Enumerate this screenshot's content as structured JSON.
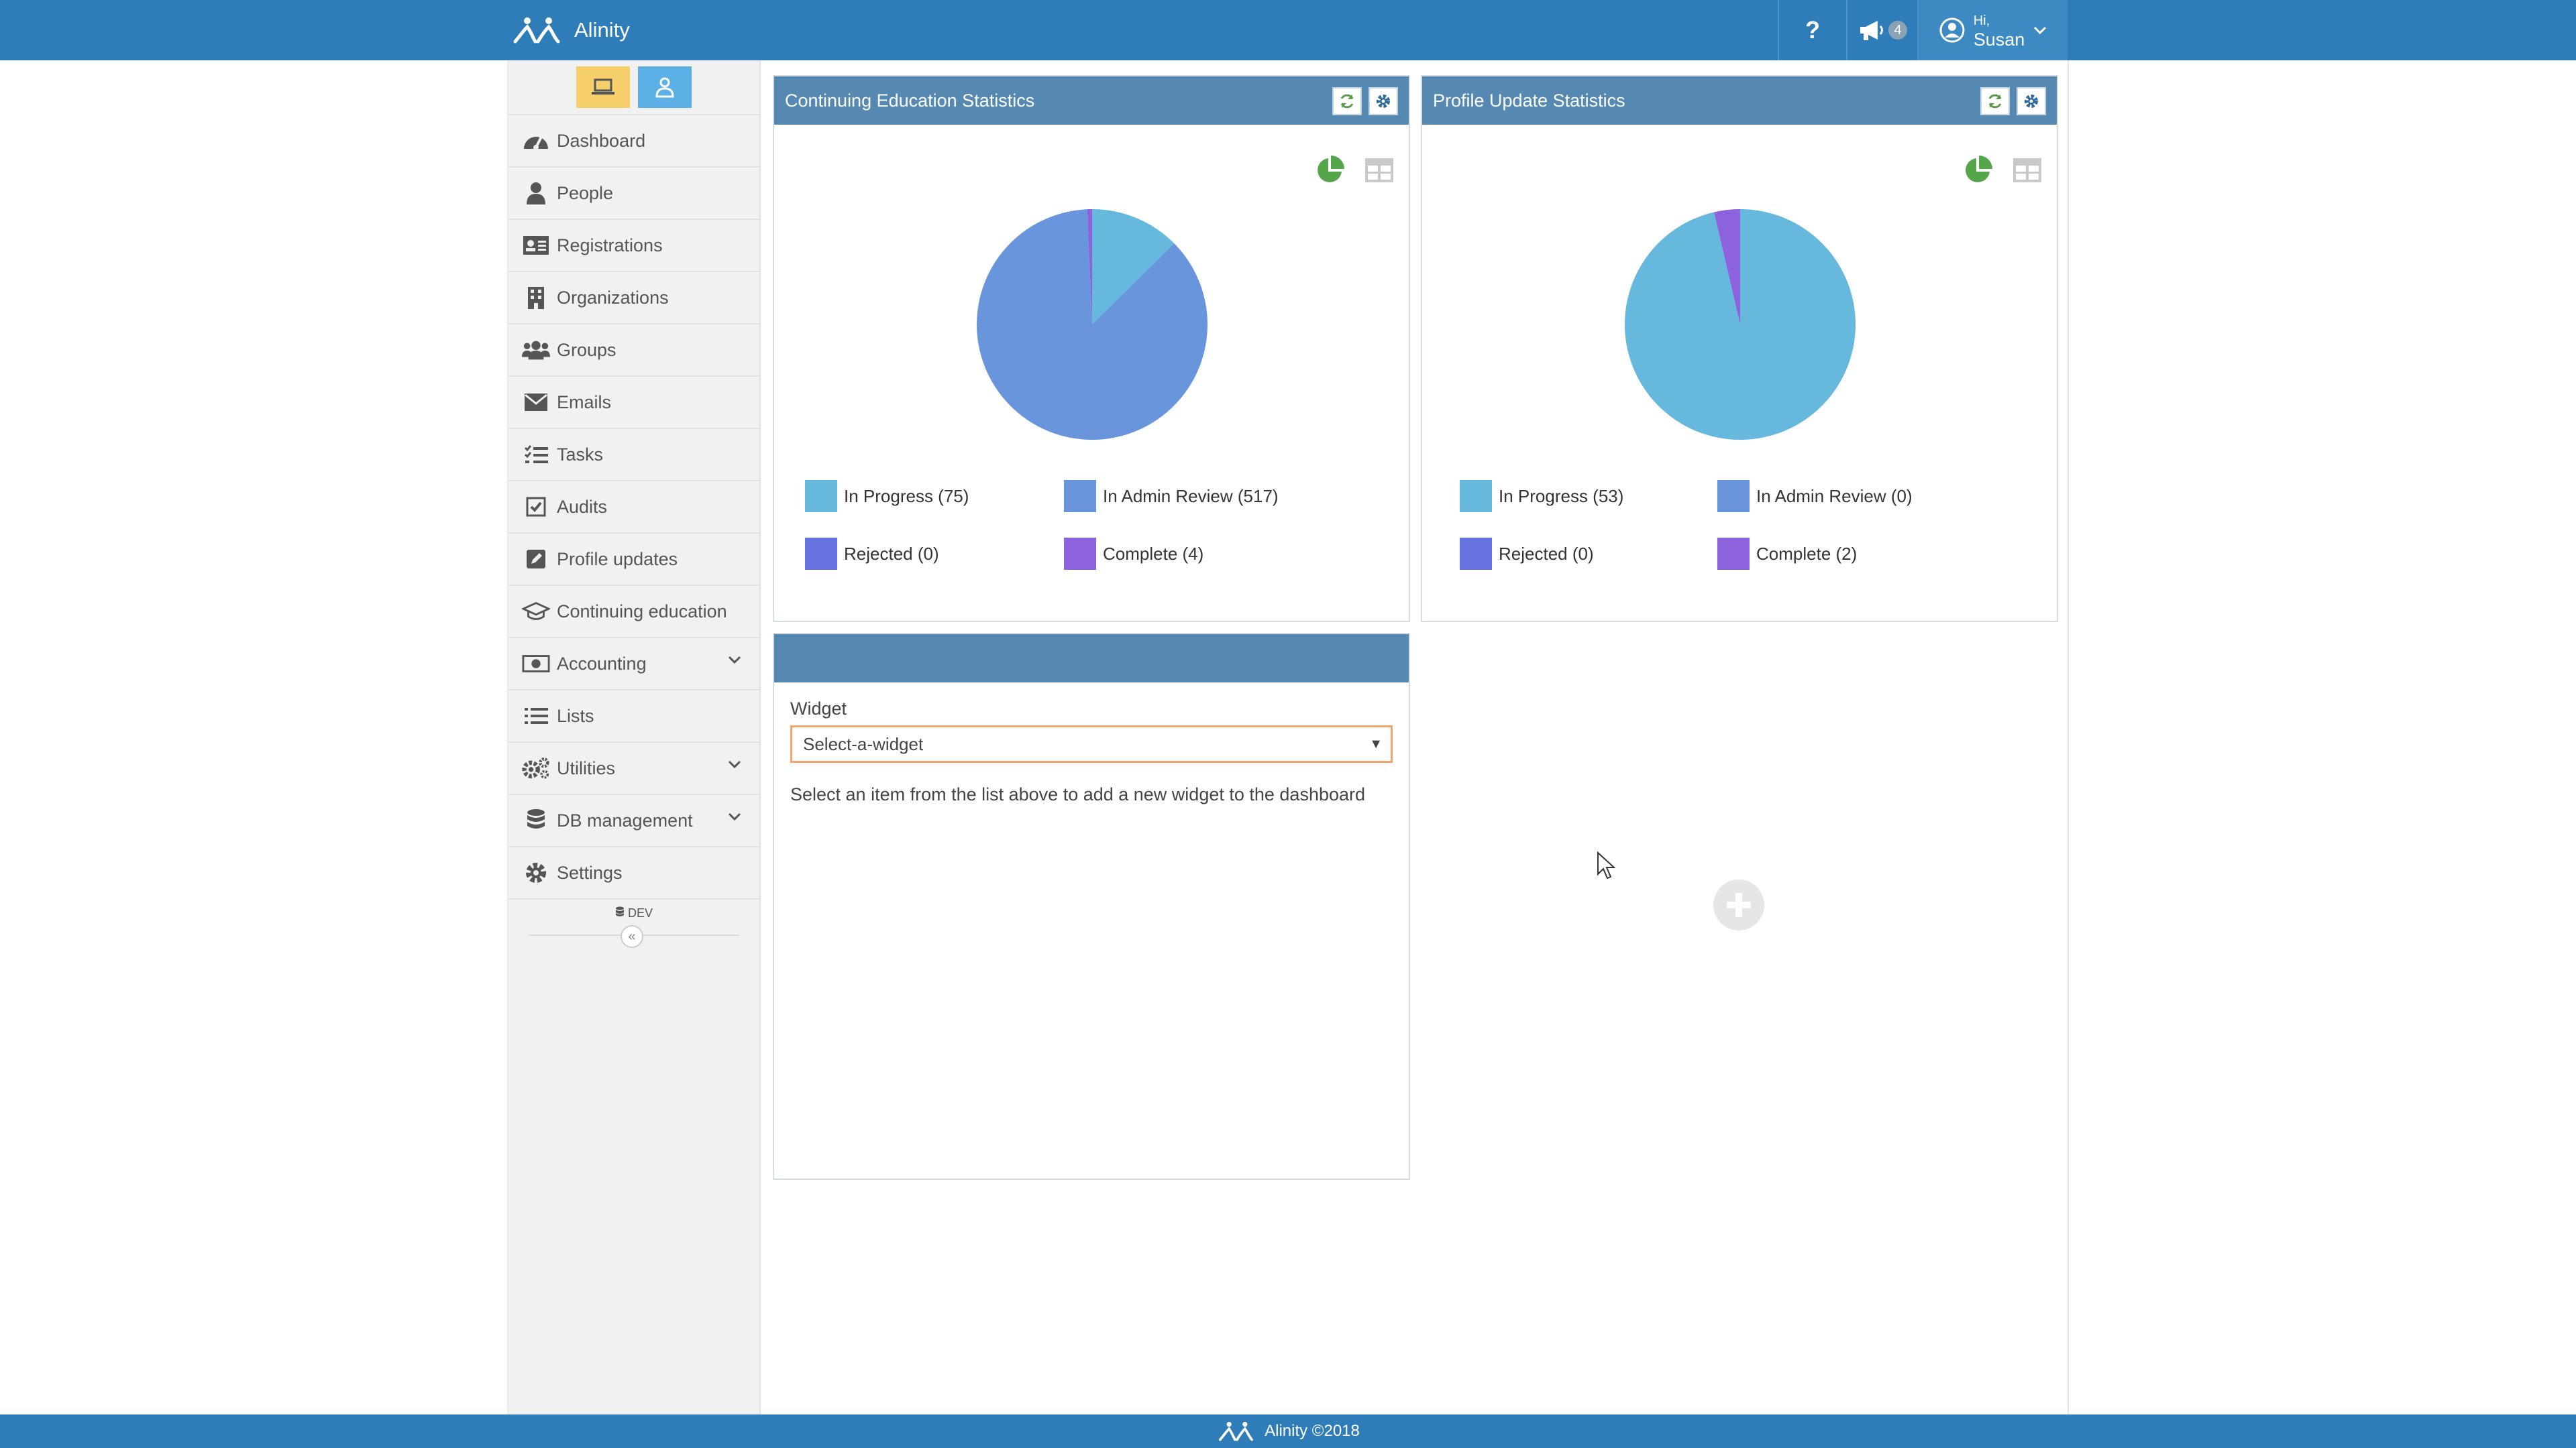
{
  "app": {
    "name": "Alinity"
  },
  "header": {
    "help_label": "?",
    "notification_count": "4",
    "greeting": "Hi,",
    "user_name": "Susan"
  },
  "sidebar": {
    "items": [
      {
        "label": "Dashboard",
        "icon": "gauge-icon"
      },
      {
        "label": "People",
        "icon": "person-icon"
      },
      {
        "label": "Registrations",
        "icon": "id-card-icon"
      },
      {
        "label": "Organizations",
        "icon": "building-icon"
      },
      {
        "label": "Groups",
        "icon": "users-icon"
      },
      {
        "label": "Emails",
        "icon": "envelope-icon"
      },
      {
        "label": "Tasks",
        "icon": "tasks-icon"
      },
      {
        "label": "Audits",
        "icon": "checkbox-icon"
      },
      {
        "label": "Profile updates",
        "icon": "edit-icon"
      },
      {
        "label": "Continuing education",
        "icon": "graduation-cap-icon"
      },
      {
        "label": "Accounting",
        "icon": "money-icon",
        "expandable": true
      },
      {
        "label": "Lists",
        "icon": "list-icon"
      },
      {
        "label": "Utilities",
        "icon": "cogs-icon",
        "expandable": true
      },
      {
        "label": "DB management",
        "icon": "database-icon",
        "expandable": true
      },
      {
        "label": "Settings",
        "icon": "gear-icon"
      }
    ],
    "env_tag": "DEV",
    "collapse_label": "«"
  },
  "panels": {
    "ce": {
      "title": "Continuing Education Statistics",
      "legend": [
        {
          "label": "In Progress (75)",
          "color": "#67b8dd"
        },
        {
          "label": "In Admin Review (517)",
          "color": "#6895dc"
        },
        {
          "label": "Rejected (0)",
          "color": "#6673e0"
        },
        {
          "label": "Complete (4)",
          "color": "#8c62dd"
        }
      ]
    },
    "profile": {
      "title": "Profile Update Statistics",
      "legend": [
        {
          "label": "In Progress (53)",
          "color": "#67b8dd"
        },
        {
          "label": "In Admin Review (0)",
          "color": "#6895dc"
        },
        {
          "label": "Rejected (0)",
          "color": "#6673e0"
        },
        {
          "label": "Complete (2)",
          "color": "#8c62dd"
        }
      ]
    },
    "widget": {
      "field_label": "Widget",
      "select_value": "Select-a-widget",
      "help_text": "Select an item from the list above to add a new widget to the dashboard"
    }
  },
  "chart_data": [
    {
      "type": "pie",
      "categories": [
        "In Progress",
        "In Admin Review",
        "Rejected",
        "Complete"
      ],
      "values": [
        75,
        517,
        0,
        4
      ],
      "colors": [
        "#67b8dd",
        "#6895dc",
        "#6673e0",
        "#8c62dd"
      ]
    },
    {
      "type": "pie",
      "categories": [
        "In Progress",
        "In Admin Review",
        "Rejected",
        "Complete"
      ],
      "values": [
        53,
        0,
        0,
        2
      ],
      "colors": [
        "#67b8dd",
        "#6895dc",
        "#6673e0",
        "#8c62dd"
      ]
    }
  ],
  "footer": {
    "text": "Alinity ©2018"
  }
}
